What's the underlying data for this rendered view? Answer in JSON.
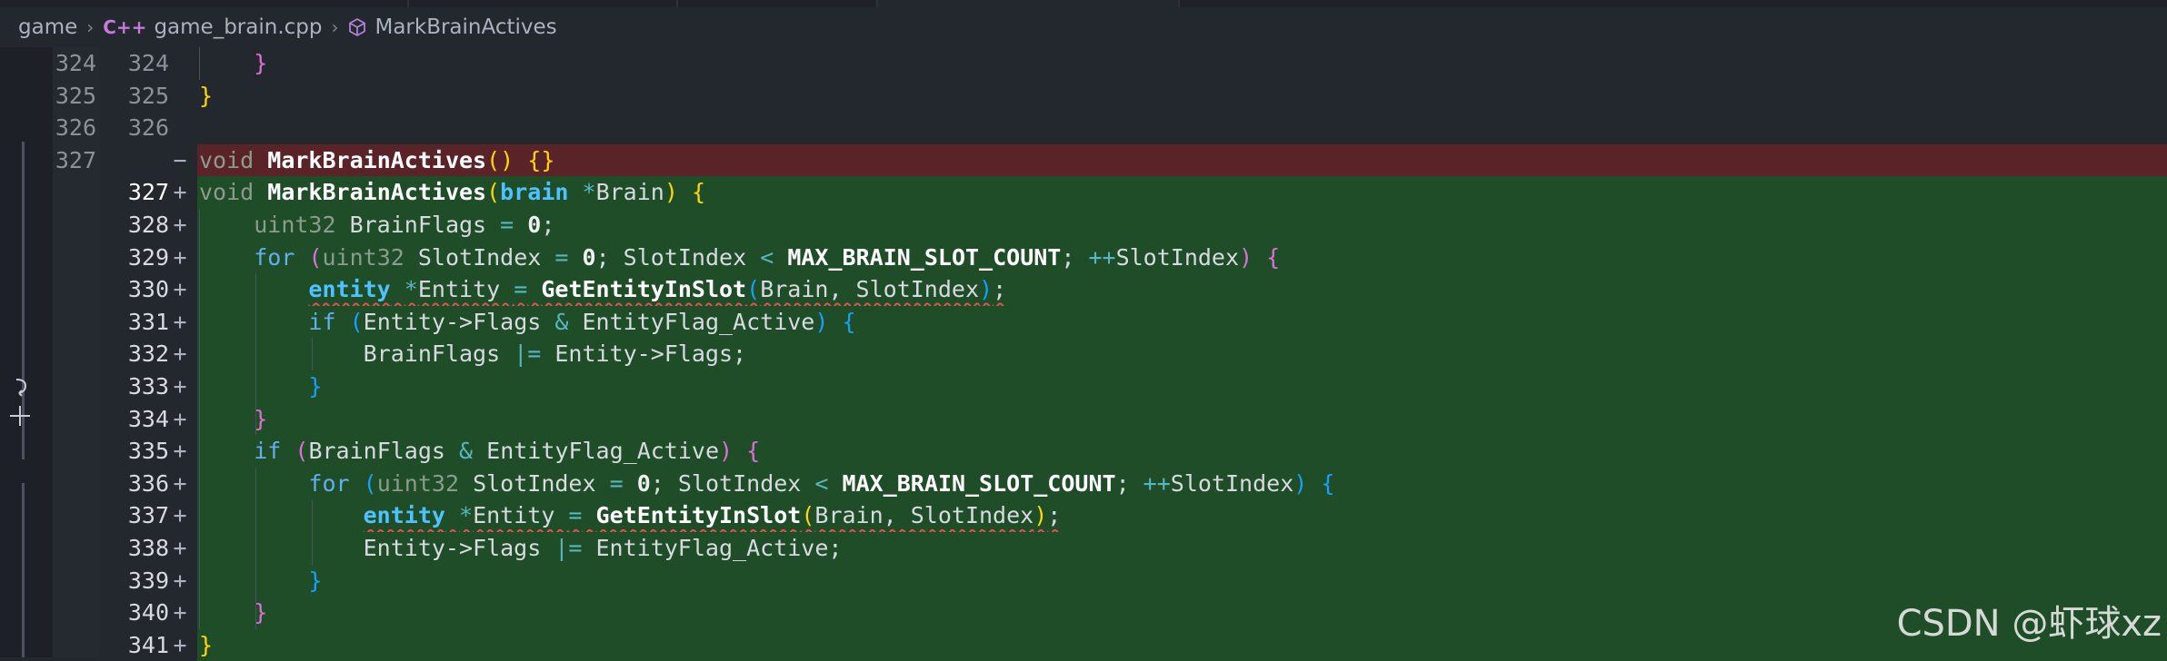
{
  "breadcrumb": {
    "folder": "game",
    "lang_badge": "C++",
    "file": "game_brain.cpp",
    "symbol": "MarkBrainActives"
  },
  "watermark": "CSDN @虾球xz",
  "colors": {
    "deleted_line_bg": "#5a2328",
    "added_line_bg": "#1f4d28",
    "keyword": "#56b6c2",
    "type": "#4fc1ff",
    "bracket_1": "#ffd700",
    "bracket_2": "#da70d6",
    "bracket_3": "#179fff",
    "squiggle": "#e05252"
  },
  "icons": [
    "chevron-right-icon",
    "cube-icon",
    "revert-icon",
    "plus-icon"
  ],
  "lines": [
    {
      "old": "324",
      "new": "324",
      "mark": "",
      "kind": "ctx"
    },
    {
      "old": "325",
      "new": "325",
      "mark": "",
      "kind": "ctx"
    },
    {
      "old": "326",
      "new": "326",
      "mark": "",
      "kind": "ctx"
    },
    {
      "old": "327",
      "new": "",
      "mark": "−",
      "kind": "del"
    },
    {
      "old": "",
      "new": "327",
      "mark": "+",
      "kind": "add"
    },
    {
      "old": "",
      "new": "328",
      "mark": "+",
      "kind": "add"
    },
    {
      "old": "",
      "new": "329",
      "mark": "+",
      "kind": "add"
    },
    {
      "old": "",
      "new": "330",
      "mark": "+",
      "kind": "add"
    },
    {
      "old": "",
      "new": "331",
      "mark": "+",
      "kind": "add"
    },
    {
      "old": "",
      "new": "332",
      "mark": "+",
      "kind": "add"
    },
    {
      "old": "",
      "new": "333",
      "mark": "+",
      "kind": "add"
    },
    {
      "old": "",
      "new": "334",
      "mark": "+",
      "kind": "add"
    },
    {
      "old": "",
      "new": "335",
      "mark": "+",
      "kind": "add"
    },
    {
      "old": "",
      "new": "336",
      "mark": "+",
      "kind": "add"
    },
    {
      "old": "",
      "new": "337",
      "mark": "+",
      "kind": "add"
    },
    {
      "old": "",
      "new": "338",
      "mark": "+",
      "kind": "add"
    },
    {
      "old": "",
      "new": "339",
      "mark": "+",
      "kind": "add"
    },
    {
      "old": "",
      "new": "340",
      "mark": "+",
      "kind": "add"
    },
    {
      "old": "",
      "new": "341",
      "mark": "+",
      "kind": "add"
    }
  ],
  "code": {
    "l0": [
      [
        "",
        "    "
      ],
      [
        "p2",
        "}"
      ]
    ],
    "l1": [
      [
        "p1",
        "}"
      ]
    ],
    "l2": [],
    "l3": [
      [
        "tyd",
        "void"
      ],
      [
        "id",
        " "
      ],
      [
        "fn",
        "MarkBrainActives"
      ],
      [
        "p1",
        "()"
      ],
      [
        "id",
        " "
      ],
      [
        "p1",
        "{}"
      ]
    ],
    "l4": [
      [
        "tyd",
        "void"
      ],
      [
        "id",
        " "
      ],
      [
        "fn",
        "MarkBrainActives"
      ],
      [
        "p1",
        "("
      ],
      [
        "ty",
        "brain"
      ],
      [
        "id",
        " "
      ],
      [
        "op",
        "*"
      ],
      [
        "id",
        "Brain"
      ],
      [
        "p1",
        ")"
      ],
      [
        "id",
        " "
      ],
      [
        "p1",
        "{"
      ]
    ],
    "l5": [
      [
        "id",
        "    "
      ],
      [
        "tyd",
        "uint32"
      ],
      [
        "id",
        " BrainFlags "
      ],
      [
        "op",
        "="
      ],
      [
        "id",
        " "
      ],
      [
        "num",
        "0"
      ],
      [
        "id",
        ";"
      ]
    ],
    "l6": [
      [
        "id",
        "    "
      ],
      [
        "kw2",
        "for"
      ],
      [
        "id",
        " "
      ],
      [
        "p2",
        "("
      ],
      [
        "tyd",
        "uint32"
      ],
      [
        "id",
        " SlotIndex "
      ],
      [
        "op",
        "="
      ],
      [
        "id",
        " "
      ],
      [
        "num",
        "0"
      ],
      [
        "id",
        "; SlotIndex "
      ],
      [
        "op",
        "<"
      ],
      [
        "id",
        " "
      ],
      [
        "mac",
        "MAX_BRAIN_SLOT_COUNT"
      ],
      [
        "id",
        "; "
      ],
      [
        "op",
        "++"
      ],
      [
        "id",
        "SlotIndex"
      ],
      [
        "p2",
        ")"
      ],
      [
        "id",
        " "
      ],
      [
        "p2",
        "{"
      ]
    ],
    "l7": [
      [
        "id",
        "        "
      ],
      [
        "ty",
        "entity"
      ],
      [
        "id",
        " "
      ],
      [
        "op",
        "*"
      ],
      [
        "id",
        "Entity "
      ],
      [
        "op",
        "="
      ],
      [
        "id",
        " "
      ],
      [
        "fn",
        "GetEntityInSlot"
      ],
      [
        "p3",
        "("
      ],
      [
        "id",
        "Brain, SlotIndex"
      ],
      [
        "p3",
        ")"
      ],
      [
        "id",
        ";"
      ]
    ],
    "l8": [
      [
        "id",
        "        "
      ],
      [
        "kw2",
        "if"
      ],
      [
        "id",
        " "
      ],
      [
        "p3",
        "("
      ],
      [
        "id",
        "Entity->Flags "
      ],
      [
        "op",
        "&"
      ],
      [
        "id",
        " EntityFlag_Active"
      ],
      [
        "p3",
        ")"
      ],
      [
        "id",
        " "
      ],
      [
        "p3",
        "{"
      ]
    ],
    "l9": [
      [
        "id",
        "            BrainFlags "
      ],
      [
        "op",
        "|="
      ],
      [
        "id",
        " Entity->Flags;"
      ]
    ],
    "l10": [
      [
        "id",
        "        "
      ],
      [
        "p3",
        "}"
      ]
    ],
    "l11": [
      [
        "id",
        "    "
      ],
      [
        "p2",
        "}"
      ]
    ],
    "l12": [
      [
        "id",
        "    "
      ],
      [
        "kw2",
        "if"
      ],
      [
        "id",
        " "
      ],
      [
        "p2",
        "("
      ],
      [
        "id",
        "BrainFlags "
      ],
      [
        "op",
        "&"
      ],
      [
        "id",
        " EntityFlag_Active"
      ],
      [
        "p2",
        ")"
      ],
      [
        "id",
        " "
      ],
      [
        "p2",
        "{"
      ]
    ],
    "l13": [
      [
        "id",
        "        "
      ],
      [
        "kw2",
        "for"
      ],
      [
        "id",
        " "
      ],
      [
        "p3",
        "("
      ],
      [
        "tyd",
        "uint32"
      ],
      [
        "id",
        " SlotIndex "
      ],
      [
        "op",
        "="
      ],
      [
        "id",
        " "
      ],
      [
        "num",
        "0"
      ],
      [
        "id",
        "; SlotIndex "
      ],
      [
        "op",
        "<"
      ],
      [
        "id",
        " "
      ],
      [
        "mac",
        "MAX_BRAIN_SLOT_COUNT"
      ],
      [
        "id",
        "; "
      ],
      [
        "op",
        "++"
      ],
      [
        "id",
        "SlotIndex"
      ],
      [
        "p3",
        ")"
      ],
      [
        "id",
        " "
      ],
      [
        "p3",
        "{"
      ]
    ],
    "l14": [
      [
        "id",
        "            "
      ],
      [
        "ty",
        "entity"
      ],
      [
        "id",
        " "
      ],
      [
        "op",
        "*"
      ],
      [
        "id",
        "Entity "
      ],
      [
        "op",
        "="
      ],
      [
        "id",
        " "
      ],
      [
        "fn",
        "GetEntityInSlot"
      ],
      [
        "p1",
        "("
      ],
      [
        "id",
        "Brain, SlotIndex"
      ],
      [
        "p1",
        ")"
      ],
      [
        "id",
        ";"
      ]
    ],
    "l15": [
      [
        "id",
        "            Entity->Flags "
      ],
      [
        "op",
        "|="
      ],
      [
        "id",
        " EntityFlag_Active;"
      ]
    ],
    "l16": [
      [
        "id",
        "        "
      ],
      [
        "p3",
        "}"
      ]
    ],
    "l17": [
      [
        "id",
        "    "
      ],
      [
        "p2",
        "}"
      ]
    ],
    "l18": [
      [
        "p1",
        "}"
      ]
    ]
  }
}
